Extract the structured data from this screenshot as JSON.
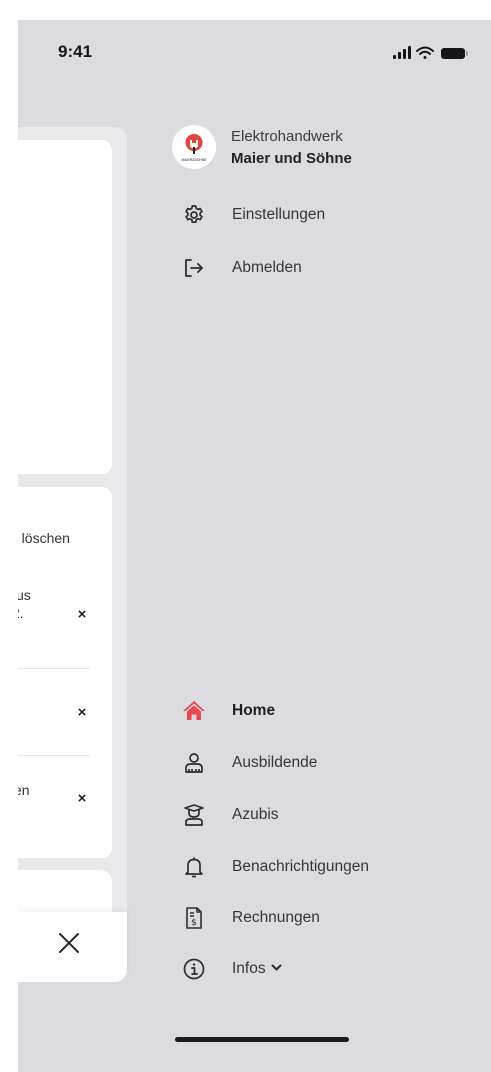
{
  "status_bar": {
    "time": "9:41",
    "icons": [
      "cellular-signal-icon",
      "wifi-icon",
      "battery-icon"
    ]
  },
  "background_page": {
    "card2_rows": [
      {
        "text_line1": "e löschen",
        "text_line2": ""
      },
      {
        "text_line1": "us",
        "text_line2": "2."
      },
      {
        "text_line1": "",
        "text_line2": ""
      },
      {
        "text_line1": "en",
        "text_line2": ""
      }
    ],
    "remove_symbol": "×",
    "close_icon": "close-icon"
  },
  "drawer": {
    "company_line1": "Elektrohandwerk",
    "company_line2": "Maier und Söhne",
    "logo_caption": "MAIER&SÖHNE",
    "top_menu": [
      {
        "label": "Einstellungen",
        "icon": "gear-icon"
      },
      {
        "label": "Abmelden",
        "icon": "logout-icon"
      }
    ],
    "main_menu": [
      {
        "label": "Home",
        "icon": "home-icon",
        "active": true
      },
      {
        "label": "Ausbildende",
        "icon": "trainer-icon",
        "active": false
      },
      {
        "label": "Azubis",
        "icon": "graduate-icon",
        "active": false
      },
      {
        "label": "Benachrichtigungen",
        "icon": "bell-icon",
        "active": false
      },
      {
        "label": "Rechnungen",
        "icon": "invoice-icon",
        "active": false
      },
      {
        "label": "Infos",
        "icon": "info-icon",
        "active": false
      }
    ]
  },
  "colors": {
    "drawer_background": "#dcdce0",
    "active_accent": "#e8484e",
    "text_dark": "#222229"
  }
}
